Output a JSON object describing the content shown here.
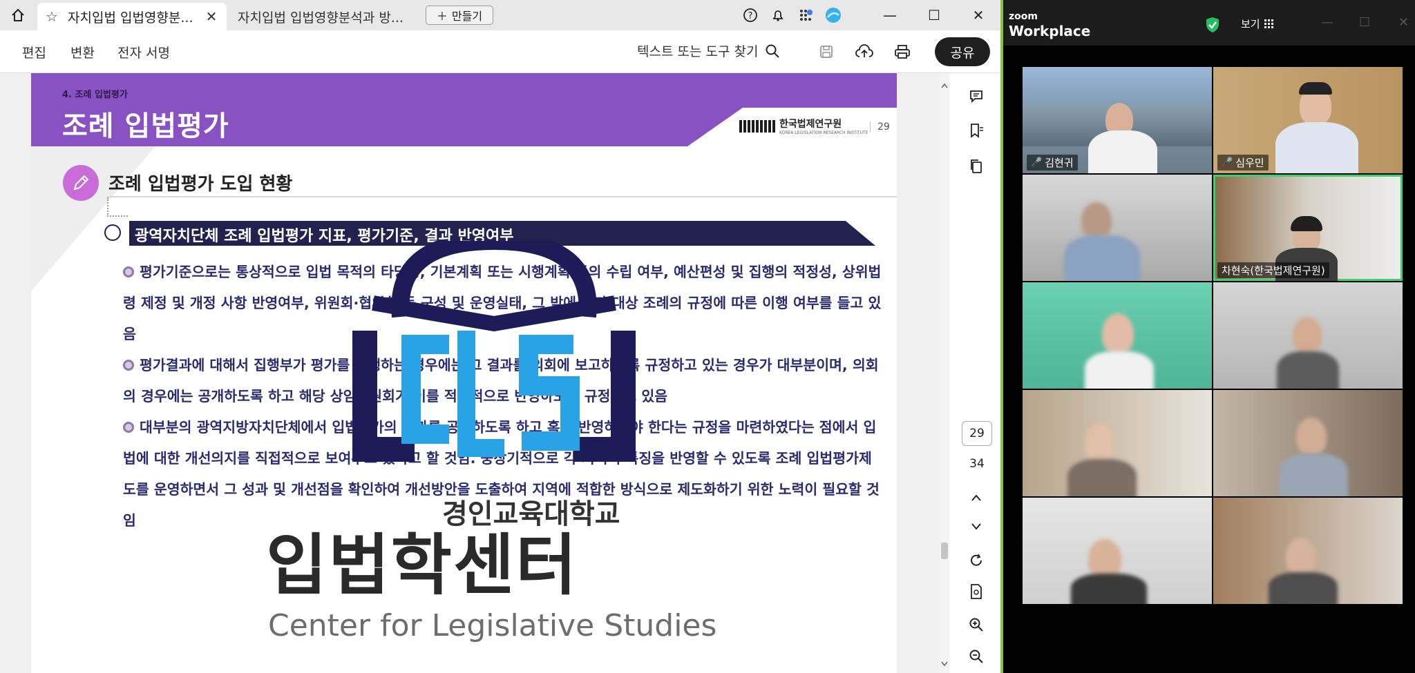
{
  "browser": {
    "tabs": [
      {
        "label": "자치입법 입법영향분...",
        "active": true
      },
      {
        "label": "자치입법 입법영향분석과 방...",
        "active": false
      }
    ],
    "new_tab_label": "만들기"
  },
  "toolbar": {
    "menu": [
      "편집",
      "변환",
      "전자 서명"
    ],
    "find_placeholder": "텍스트 또는 도구 찾기",
    "share_label": "공유"
  },
  "viewer": {
    "current_page": "29",
    "total_pages": "34"
  },
  "slide": {
    "breadcrumb": "4. 조례 입법평가",
    "title": "조례 입법평가",
    "org_name": "한국법제연구원",
    "org_subtitle": "KOREA LEGISLATION RESEARCH INSTITUTE",
    "page_number": "29",
    "section_heading": "조례 입법평가 도입 현황",
    "banner": "광역자치단체  조례 입법평가 지표, 평가기준, 결과 반영여부",
    "paragraphs": [
      "평가기준으로는 통상적으로 입법 목적의 타당성, 기본계획 또는 시행계획 등의 수립 여부, 예산편성 및 집행의 적정성, 상위법령 제정 및 개정 사항 반영여부, 위원회·협의회 등 구성 및 운영실태, 그 밖에 평가 대상 조례의 규정에 따른 이행 여부를 들고 있음",
      "평가결과에 대해서 집행부가 평가를 진행하는 경우에는 그 결과를 의회에 보고하도록 규정하고 있는 경우가 대부분이며, 의회의 경우에는 공개하도록 하고 해당 상임위원회가 이를 적극적으로 반영하도록 규정하고 있음",
      "대부분의 광역지방자치단체에서 입법평가의 결과를 공개하도록 하고 혹은 반영하여야 한다는 규정을 마련하였다는 점에서 입법에 대한 개선의지를 직접적으로 보여주고 있다고 할 것임. 중장기적으로 각 지역의 특징을 반영할 수 있도록 조례 입법평가제도를 운영하면서 그 성과 및 개선점을 확인하여 개선방안을 도출하여 지역에 적합한 방식으로 제도화하기 위한 노력이 필요할 것임"
    ],
    "watermark": {
      "small": "경인교육대학교",
      "big": "입법학센터",
      "english": "Center for Legislative Studies"
    }
  },
  "zoom": {
    "brand_small": "zoom",
    "brand_big": "Workplace",
    "view_label": "보기",
    "participants": [
      {
        "name": "김현귀",
        "muted": true,
        "speaking": false
      },
      {
        "name": "심우민",
        "muted": true,
        "speaking": false
      },
      {
        "name": "",
        "muted": false,
        "speaking": false
      },
      {
        "name": "차현숙(한국법제연구원)",
        "muted": false,
        "speaking": true
      },
      {
        "name": "",
        "muted": false,
        "speaking": false
      },
      {
        "name": "",
        "muted": false,
        "speaking": false
      },
      {
        "name": "",
        "muted": false,
        "speaking": false
      },
      {
        "name": "",
        "muted": false,
        "speaking": false
      },
      {
        "name": "",
        "muted": false,
        "speaking": false
      },
      {
        "name": "",
        "muted": false,
        "speaking": false
      }
    ]
  },
  "colors": {
    "slide_band": "#8852c2",
    "banner": "#23224f",
    "body_text": "#2a2a6e",
    "zoom_speaking": "#3ad36b",
    "window_divider": "#8bc34a"
  }
}
